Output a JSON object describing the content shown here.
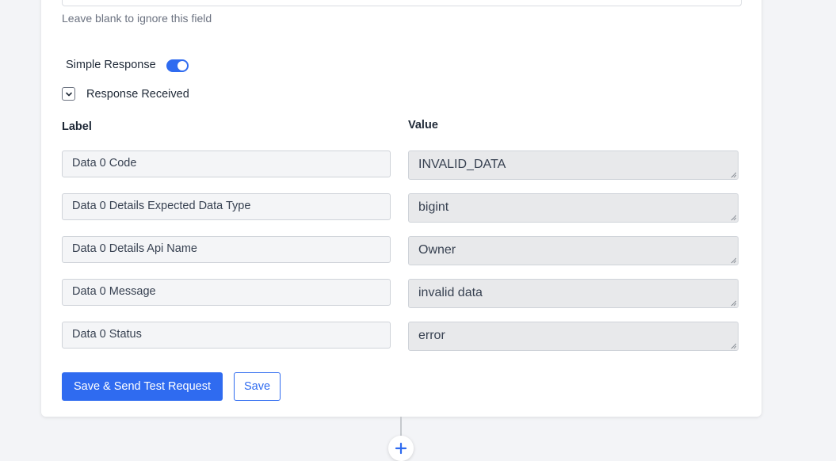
{
  "field": {
    "hint": "Leave blank to ignore this field"
  },
  "simple_response": {
    "label": "Simple Response",
    "enabled": true
  },
  "response_received": {
    "label": "Response Received"
  },
  "table": {
    "label_header": "Label",
    "value_header": "Value",
    "rows": [
      {
        "label": "Data 0 Code",
        "value": "INVALID_DATA"
      },
      {
        "label": "Data 0 Details Expected Data Type",
        "value": "bigint"
      },
      {
        "label": "Data 0 Details Api Name",
        "value": "Owner"
      },
      {
        "label": "Data 0 Message",
        "value": "invalid data"
      },
      {
        "label": "Data 0 Status",
        "value": "error"
      }
    ]
  },
  "actions": {
    "save_send_label": "Save & Send Test Request",
    "save_label": "Save"
  },
  "colors": {
    "accent": "#2f6bf0",
    "page_bg": "#f3f4f7"
  },
  "icons": {
    "collapse": "chevron-down-icon",
    "resize": "resize-handle-icon",
    "add": "plus-icon"
  }
}
